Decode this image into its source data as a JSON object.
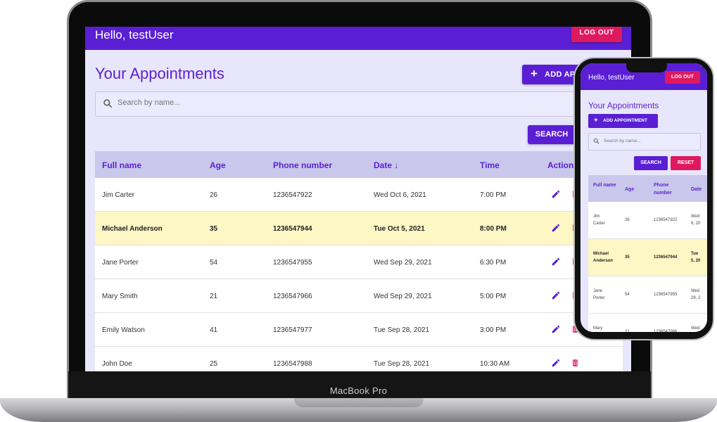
{
  "device_label": "MacBook Pro",
  "colors": {
    "primary": "#5a1fd4",
    "danger": "#e0195f",
    "highlight": "#fdf6c5",
    "table_header": "#c9c8ec"
  },
  "app": {
    "greeting": "Hello, testUser",
    "logout_label": "LOG OUT",
    "page_title": "Your Appointments",
    "add_label": "ADD APPOINTMENT",
    "add_label_visible": "ADD APP",
    "search": {
      "placeholder": "Search by name..."
    },
    "search_label": "SEARCH",
    "reset_label": "RESET",
    "columns": {
      "name": "Full name",
      "age": "Age",
      "phone": "Phone number",
      "date": "Date",
      "time": "Time",
      "actions": "Actions"
    },
    "phone_columns": {
      "name": "Full name",
      "age": "Age",
      "phone": "Phone number",
      "date": "Date"
    },
    "sort_indicator": "↓",
    "icons": {
      "search": "search-icon",
      "plus": "plus-icon",
      "edit": "pencil-icon",
      "delete": "trash-icon",
      "sort": "arrow-down-icon"
    },
    "rows": [
      {
        "name": "Jim Carter",
        "age": "26",
        "phone": "1236547922",
        "date": "Wed Oct 6, 2021",
        "time": "7:00 PM",
        "highlight": false
      },
      {
        "name": "Michael Anderson",
        "age": "35",
        "phone": "1236547944",
        "date": "Tue Oct 5, 2021",
        "time": "8:00 PM",
        "highlight": true
      },
      {
        "name": "Jane Porter",
        "age": "54",
        "phone": "1236547955",
        "date": "Wed Sep 29, 2021",
        "time": "6:30 PM",
        "highlight": false
      },
      {
        "name": "Mary Smith",
        "age": "21",
        "phone": "1236547966",
        "date": "Wed Sep 29, 2021",
        "time": "5:00 PM",
        "highlight": false
      },
      {
        "name": "Emily Watson",
        "age": "41",
        "phone": "1236547977",
        "date": "Tue Sep 28, 2021",
        "time": "3:00 PM",
        "highlight": false
      },
      {
        "name": "John Doe",
        "age": "25",
        "phone": "1236547988",
        "date": "Tue Sep 28, 2021",
        "time": "10:30 AM",
        "highlight": false
      }
    ],
    "phone_rows": [
      {
        "name_l1": "Jim",
        "name_l2": "Carter",
        "age": "26",
        "phone": "1236547922",
        "date_l1": "Wed",
        "date_l2": "6, 20"
      },
      {
        "name_l1": "Michael",
        "name_l2": "Anderson",
        "age": "35",
        "phone": "1236547944",
        "date_l1": "Tue",
        "date_l2": "5, 20"
      },
      {
        "name_l1": "Jane",
        "name_l2": "Porter",
        "age": "54",
        "phone": "1236547955",
        "date_l1": "Wed",
        "date_l2": "29, 2"
      },
      {
        "name_l1": "Mary",
        "name_l2": "",
        "age": "21",
        "phone": "1236547966",
        "date_l1": "Wed",
        "date_l2": ""
      }
    ]
  }
}
